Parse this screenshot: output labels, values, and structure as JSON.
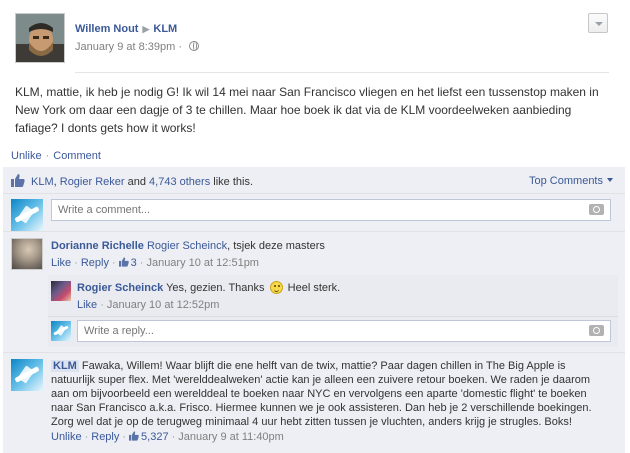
{
  "post": {
    "author": "Willem Nout",
    "target": "KLM",
    "timestamp": "January 9 at 8:39pm",
    "meta_sep": "·",
    "privacy_icon": "globe-icon",
    "text": "KLM, mattie, ik heb je nodig G! Ik wil 14 mei naar San Francisco vliegen en het liefst een tussenstop maken in New York om daar een dagje of 3 te chillen. Maar hoe boek ik dat via de KLM voordeelweken aanbieding fafiage? I donts gets how it works!"
  },
  "actions": {
    "unlike": "Unlike",
    "comment": "Comment",
    "sep": "·"
  },
  "likes": {
    "first": "KLM",
    "second": "Rogier Reker",
    "and": "and",
    "others": "4,743 others",
    "suffix": "like this.",
    "sep": ","
  },
  "sort": {
    "label": "Top Comments"
  },
  "write_comment": {
    "placeholder": "Write a comment..."
  },
  "comments": [
    {
      "author": "Dorianne Richelle",
      "mention": "Rogier Scheinck",
      "text": ", tsjek deze masters",
      "like": "Like",
      "reply": "Reply",
      "likes": "3",
      "time": "January 10 at 12:51pm",
      "replies": [
        {
          "author": "Rogier Scheinck",
          "text_before": "Yes, gezien. Thanks",
          "text_after": "Heel sterk.",
          "like": "Like",
          "time": "January 10 at 12:52pm"
        }
      ],
      "reply_placeholder": "Write a reply..."
    },
    {
      "author": "KLM",
      "text": "Fawaka, Willem! Waar blijft die ene helft van de twix, mattie? Paar dagen chillen in The Big Apple is natuurlijk super flex. Met 'werelddealweken' actie kan je alleen een zuivere retour boeken. We raden je daarom aan om bijvoorbeeld een werelddeal te boeken naar NYC en vervolgens een aparte 'domestic flight' te boeken naar San Francisco a.k.a. Frisco. Hiermee kunnen we je ook assisteren. Dan heb je 2 verschillende boekingen. Zorg wel dat je op de terugweg minimaal 4 uur hebt zitten tussen je vluchten, anders krijg je strugles. Boks!",
      "unlike": "Unlike",
      "reply": "Reply",
      "likes": "5,327",
      "time": "January 9 at 11:40pm"
    }
  ],
  "colors": {
    "link": "#3b5998",
    "feedback_bg": "#edeff4",
    "meta": "#808080"
  }
}
